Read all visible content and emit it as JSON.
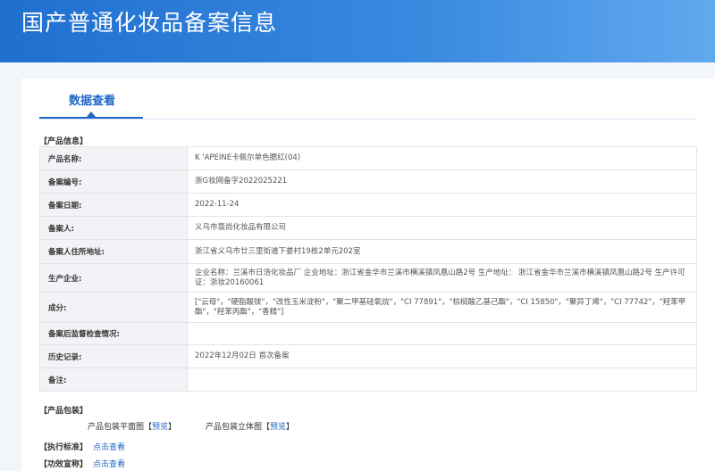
{
  "header": {
    "title": "国产普通化妆品备案信息"
  },
  "tab": {
    "label": "数据查看"
  },
  "product_section": {
    "title": "【产品信息】"
  },
  "rows": [
    {
      "label": "产品名称:",
      "value": "K 'APEINE卡佩尔单色腮红(04)"
    },
    {
      "label": "备案编号:",
      "value": "浙G妆网备字2022025221"
    },
    {
      "label": "备案日期:",
      "value": "2022-11-24"
    },
    {
      "label": "备案人:",
      "value": "义乌市翡尚化妆品有限公司"
    },
    {
      "label": "备案人住所地址:",
      "value": "浙江省义乌市廿三里街道下娄村19栋2单元202室"
    },
    {
      "label": "生产企业:",
      "value": "企业名称：兰溪市日浩化妆品厂 企业地址：浙江省金华市兰溪市横溪镇凤凰山路2号 生产地址： 浙江省金华市兰溪市横溪镇凤凰山路2号 生产许可证：浙妆20160061"
    },
    {
      "label": "成分:",
      "value": "[\"云母\"，\"硬脂酸镁\"，\"改性玉米淀粉\"，\"聚二甲基硅氧烷\"，\"CI 77891\"，\"棕榈酸乙基己酯\"，\"CI 15850\"，\"聚异丁烯\"，\"CI 77742\"，\"羟苯甲酯\"，\"羟苯丙酯\"，\"香精\"]"
    },
    {
      "label": "备案后监督检查情况:",
      "value": ""
    },
    {
      "label": "历史记录:",
      "value": "2022年12月02日 首次备案"
    },
    {
      "label": "备注:",
      "value": ""
    }
  ],
  "package_section": {
    "title": "【产品包装】",
    "flat_label": "产品包装平面图",
    "solid_label": "产品包装立体图",
    "bracket_open": "【",
    "bracket_close": "】",
    "preview_link": "预览"
  },
  "standard_section": {
    "title": "【执行标准】",
    "link": "点击查看"
  },
  "efficacy_section": {
    "title": "【功效宣称】",
    "link": "点击查看"
  }
}
